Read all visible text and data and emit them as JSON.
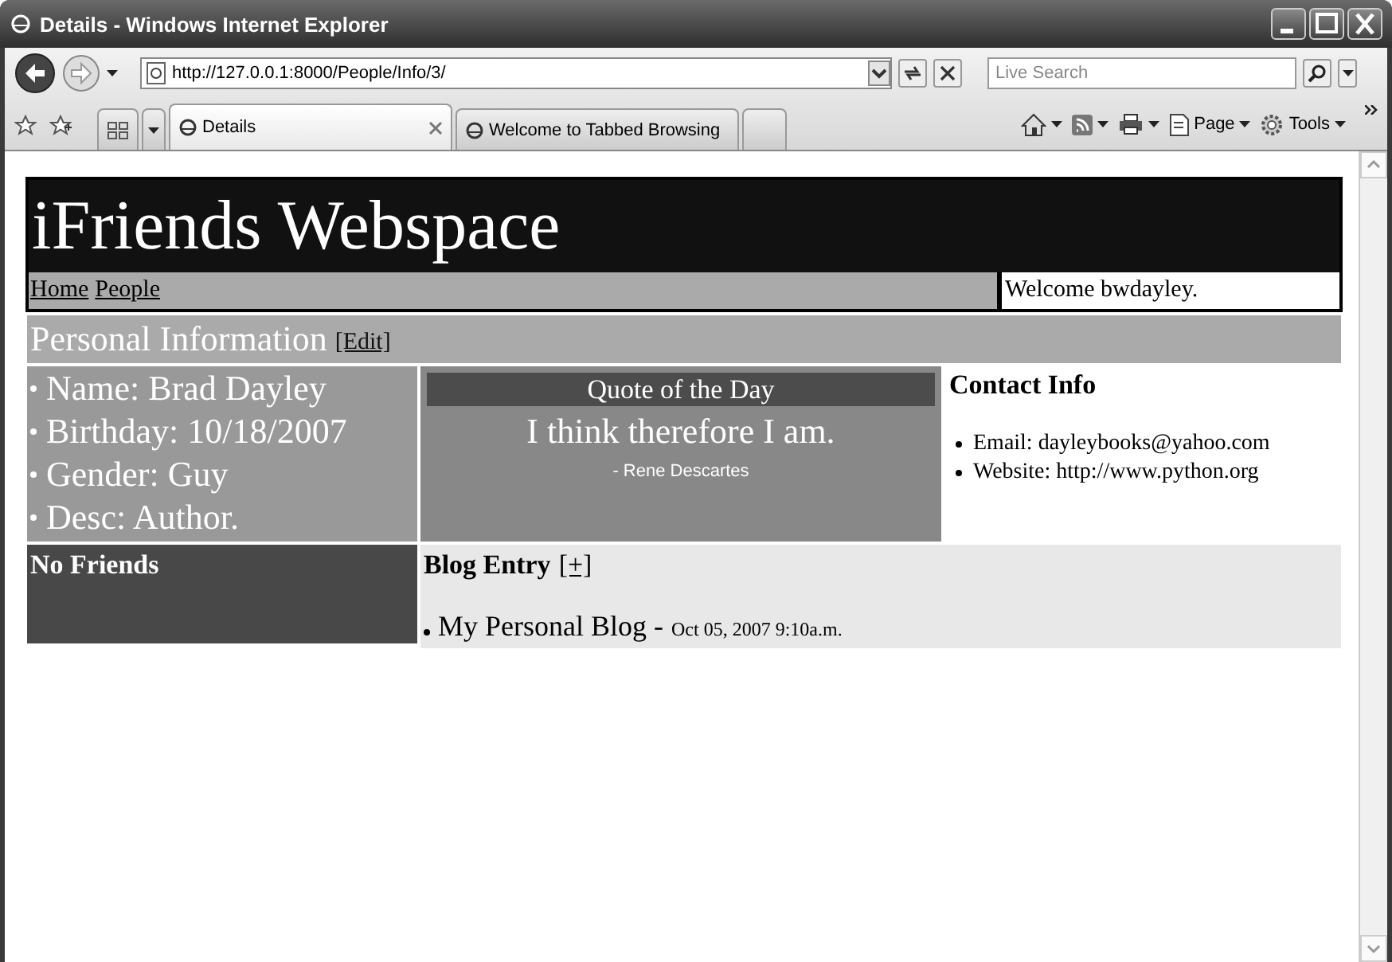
{
  "window": {
    "title": "Details - Windows Internet Explorer"
  },
  "address_bar": {
    "url": "http://127.0.0.1:8000/People/Info/3/"
  },
  "search": {
    "placeholder": "Live Search"
  },
  "tabs": [
    {
      "label": "Details",
      "selected": true
    },
    {
      "label": "Welcome to Tabbed Browsing",
      "selected": false
    }
  ],
  "command_bar": [
    {
      "kind": "home"
    },
    {
      "kind": "feeds"
    },
    {
      "kind": "print"
    },
    {
      "kind": "page",
      "label": "Page"
    },
    {
      "kind": "tools",
      "label": "Tools"
    }
  ],
  "page": {
    "site_title": "iFriends Webspace",
    "nav_links": [
      "Home",
      "People"
    ],
    "welcome": "Welcome bwdayley.",
    "section": {
      "title": "Personal Information",
      "edit_link": "[Edit]"
    },
    "details": [
      "Name: Brad Dayley",
      "Birthday: 10/18/2007",
      "Gender: Guy",
      "Desc: Author."
    ],
    "quote": {
      "heading": "Quote of the Day",
      "text": "I think therefore I am.",
      "author": "- Rene Descartes"
    },
    "contact": {
      "heading": "Contact Info",
      "items": [
        "Email: dayleybooks@yahoo.com",
        "Website: http://www.python.org"
      ]
    },
    "friends": {
      "heading": "No Friends"
    },
    "blog": {
      "heading": "Blog Entry",
      "add_link": "[+]",
      "entries": [
        {
          "title": "My Personal Blog -",
          "date": "Oct 05, 2007 9:10a.m."
        }
      ]
    }
  }
}
